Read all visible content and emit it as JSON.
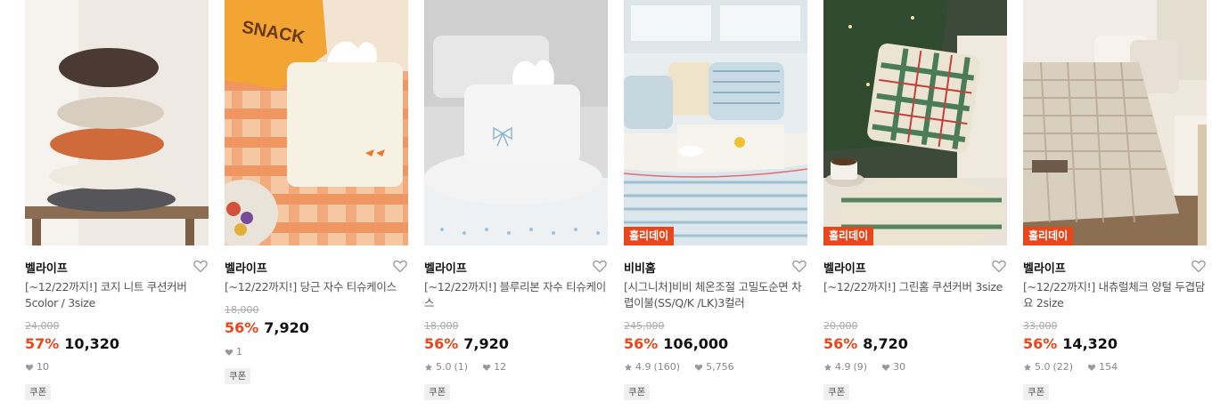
{
  "colors": {
    "accent": "#e8461b",
    "holiday_badge": "#e8461b"
  },
  "products": [
    {
      "brand": "벨라이프",
      "name": "[~12/22까지!] 코지 니트 쿠션커버 5color / 3size",
      "original_price": "24,000",
      "discount": "57%",
      "price": "10,320",
      "rating": "",
      "reviews": "",
      "likes": "10",
      "badge": "",
      "coupon": "쿠폰",
      "image": "stacked knit cushions on a bench"
    },
    {
      "brand": "벨라이프",
      "name": "[~12/22까지!] 당근 자수 티슈케이스",
      "original_price": "18,000",
      "discount": "56%",
      "price": "7,920",
      "rating": "",
      "reviews": "",
      "likes": "1",
      "badge": "",
      "coupon": "쿠폰",
      "image": "carrot embroidered tissue case on orange gingham"
    },
    {
      "brand": "벨라이프",
      "name": "[~12/22까지!] 블루리본 자수 티슈케이스",
      "original_price": "18,000",
      "discount": "56%",
      "price": "7,920",
      "rating": "5.0",
      "reviews": "(1)",
      "likes": "12",
      "badge": "",
      "coupon": "쿠폰",
      "image": "white tissue case with blue ribbon"
    },
    {
      "brand": "비비홈",
      "name": "[시그니처]비비 체온조절 고밀도순면 차렵이불(SS/Q/K /LK)3컬러",
      "original_price": "245,000",
      "discount": "56%",
      "price": "106,000",
      "rating": "4.9",
      "reviews": "(160)",
      "likes": "5,756",
      "badge": "홀리데이",
      "coupon": "쿠폰",
      "image": "striped bedding set"
    },
    {
      "brand": "벨라이프",
      "name": "[~12/22까지!] 그린홈 쿠션커버 3size",
      "original_price": "20,000",
      "discount": "56%",
      "price": "8,720",
      "rating": "4.9",
      "reviews": "(9)",
      "likes": "30",
      "badge": "홀리데이",
      "coupon": "쿠폰",
      "image": "green tartan cushions by christmas tree"
    },
    {
      "brand": "벨라이프",
      "name": "[~12/22까지!] 내츄럴체크 양털 두겹담요 2size",
      "original_price": "33,000",
      "discount": "56%",
      "price": "14,320",
      "rating": "5.0",
      "reviews": "(22)",
      "likes": "154",
      "badge": "홀리데이",
      "coupon": "쿠폰",
      "image": "natural check blanket on sofa"
    }
  ]
}
